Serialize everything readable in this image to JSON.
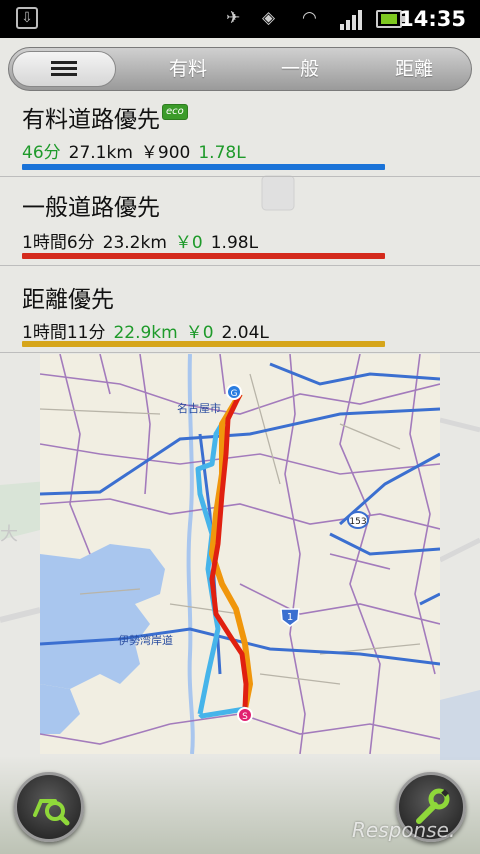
{
  "statusbar": {
    "time": "14:35"
  },
  "tabs": [
    {
      "label": ""
    },
    {
      "label": "有料"
    },
    {
      "label": "一般"
    },
    {
      "label": "距離"
    }
  ],
  "routes": [
    {
      "name": "有料道路優先",
      "badge": "eco",
      "time": "46分",
      "distance": "27.1km",
      "toll": "￥900",
      "fuel": "1.78L",
      "color": "#1a73d8"
    },
    {
      "name": "一般道路優先",
      "time": "1時間6分",
      "distance": "23.2km",
      "toll": "￥0",
      "fuel": "1.98L",
      "color": "#d42a1c"
    },
    {
      "name": "距離優先",
      "time": "1時間11分",
      "distance": "22.9km",
      "toll": "￥0",
      "fuel": "2.04L",
      "color": "#d6a51a"
    }
  ],
  "map": {
    "labels": {
      "city": "名古屋市",
      "expressway": "伊勢湾岸道",
      "route153": "153",
      "route1": "1",
      "goal_marker": "G",
      "start_marker": "S"
    }
  },
  "bottom": {
    "watermark": "Response."
  }
}
